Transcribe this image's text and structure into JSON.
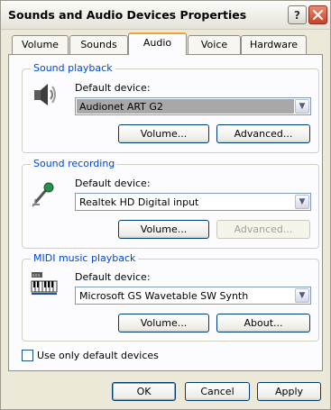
{
  "window": {
    "title": "Sounds and Audio Devices Properties"
  },
  "titlebar": {
    "help_glyph": "?",
    "close_glyph": "✕"
  },
  "tabs": [
    {
      "label": "Volume"
    },
    {
      "label": "Sounds"
    },
    {
      "label": "Audio"
    },
    {
      "label": "Voice"
    },
    {
      "label": "Hardware"
    }
  ],
  "active_tab": "Audio",
  "playback": {
    "title": "Sound playback",
    "device_label": "Default device:",
    "device_value": "Audionet ART G2",
    "volume_label": "Volume...",
    "advanced_label": "Advanced..."
  },
  "recording": {
    "title": "Sound recording",
    "device_label": "Default device:",
    "device_value": "Realtek HD Digital input",
    "volume_label": "Volume...",
    "advanced_label": "Advanced..."
  },
  "midi": {
    "title": "MIDI music playback",
    "device_label": "Default device:",
    "device_value": "Microsoft GS Wavetable SW Synth",
    "volume_label": "Volume...",
    "about_label": "About..."
  },
  "options": {
    "default_only_label": "Use only default devices",
    "default_only_checked": false
  },
  "footer": {
    "ok_label": "OK",
    "cancel_label": "Cancel",
    "apply_label": "Apply"
  },
  "colors": {
    "group_title": "#0046d5",
    "active_tab_accent": "#f3a32f"
  }
}
